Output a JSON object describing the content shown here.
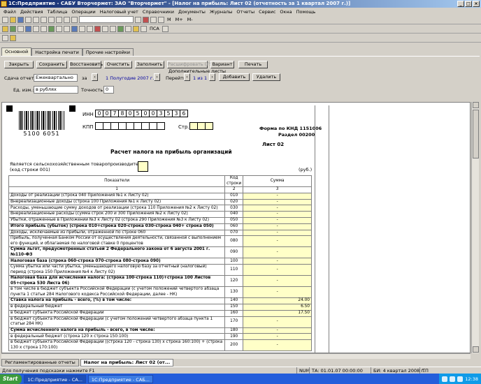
{
  "window": {
    "title": "1С:Предприятие - САБУ Вторчермет: ЗАО \"Вторчермет\" - [Налог на прибыль: Лист 02 (отчетность за 1 квартал 2007 г.)]"
  },
  "menu": [
    "Файл",
    "Действия",
    "Таблица",
    "Операции",
    "Налоговый учет",
    "Справочники",
    "Документы",
    "Журналы",
    "Отчеты",
    "Сервис",
    "Окна",
    "Помощь"
  ],
  "toolbar": {
    "m_label": "M",
    "mplus": "M+",
    "mminus": "M-",
    "pca": "ПСА"
  },
  "tabs": [
    "Основной",
    "Настройка печати",
    "Прочие настройки"
  ],
  "buttons": {
    "close": "Закрыть",
    "save": "Сохранить",
    "restore": "Восстановить",
    "clear": "Очистить",
    "fill": "Заполнить",
    "expand": "Расшифровать (F5)",
    "variant": "Вариант",
    "print": "Печать",
    "add": "Добавить",
    "remove": "Удалить"
  },
  "form": {
    "period_label": "Сдача отчета:",
    "period_value": "Ежеквартально",
    "za": "за",
    "period": "1 Полугодие 2007 г.",
    "extra_sheets": "Дополнительные листы",
    "goto": "Перейти",
    "sheet_pos": "1 из 1",
    "unit_label": "Ед. изм.:",
    "unit_value": "в рублях",
    "precision_label": "Точность:",
    "precision_value": "0"
  },
  "report": {
    "barcode_number": "5100 6051",
    "inn_label": "ИНН",
    "inn": [
      "0",
      "0",
      "7",
      "8",
      "0",
      "5",
      "0",
      "0",
      "3",
      "5",
      "3",
      "6"
    ],
    "kpp_label": "КПП",
    "page_label": "Стр.",
    "form_code": "Форма по КНД 1151006",
    "section": "Раздел 00200",
    "sheet": "Лист 02",
    "title": "Расчет налога на прибыль организаций",
    "agri_label": "Является сельскохозяйственным товаропроизводителем",
    "agri_code": "(код строки 001)",
    "currency": "(руб.)",
    "headers": {
      "col1": "Показатели",
      "col2": "Код строки",
      "col3": "Сумма"
    },
    "colnums": [
      "1",
      "2",
      "3"
    ],
    "rows": [
      {
        "name": "Доходы от реализации  (строка 040 Приложения №1 к Листу 02)",
        "code": "010",
        "value": "-",
        "bold": false
      },
      {
        "name": "Внереализационные доходы (строка 100 Приложения №1 к Листу 02)",
        "code": "020",
        "value": "-",
        "bold": false
      },
      {
        "name": "Расходы, уменьшающие сумму доходов от реализации (строка 110 Приложения №2 к Листу 02)",
        "code": "030",
        "value": "-",
        "bold": false
      },
      {
        "name": "Внереализационные расходы (сумма строк 200 и 300 Приложения №2 к Листу 02)",
        "code": "040",
        "value": "-",
        "bold": false
      },
      {
        "name": "Убытки, отраженные в Приложении №3 к Листу 02 (строка 290 Приложения №3 к Листу 02)",
        "code": "050",
        "value": "-",
        "bold": false
      },
      {
        "name": "Итого прибыль (убыток) (строка 010+строка 020-строка 030-строка 040+ строка 050)",
        "code": "060",
        "value": "-",
        "bold": true
      },
      {
        "name": "Доходы, исключаемые из прибыли, отраженной по строке 060",
        "code": "070",
        "value": "-",
        "bold": false
      },
      {
        "name": "Прибыль, полученная Банком России от осуществления деятельности, связанной с выполнением его функций, и облагаемая по налоговой ставке 0 процентов",
        "code": "080",
        "value": "-",
        "bold": false
      },
      {
        "name": "Сумма льгот, предусмотренных статьей 2 Федерального закона от 6 августа 2001 г. №110-ФЗ",
        "code": "090",
        "value": "-",
        "bold": true
      },
      {
        "name": "Налоговая база (строка 060-строка 070-строка 080-строка 090)",
        "code": "100",
        "value": "-",
        "bold": true
      },
      {
        "name": "Сумма убытка или части убытка, уменьшающего налоговую базу за отчетный (налоговый) период (строка 150 Приложения №4 к Листу 02)",
        "code": "110",
        "value": "-",
        "bold": false
      },
      {
        "name": "Налоговая база для исчисления налога: (строка 100-строка 110)+строка 100 Листов 05+строка 530 Листа 06)",
        "code": "120",
        "value": "-",
        "bold": true
      },
      {
        "name": "   в том числе в бюджет субъекта Российской Федерации (с учетом положений четвертого абзаца пункта 1 статьи 284 Налогового кодекса Российской Федерации, далее - НК)",
        "code": "130",
        "value": "-",
        "bold": false
      },
      {
        "name": "Ставка налога на прибыль - всего, (%) в том числе:",
        "code": "140",
        "value": "24.00",
        "bold": true
      },
      {
        "name": "   в федеральный бюджет",
        "code": "150",
        "value": "6.50",
        "bold": false
      },
      {
        "name": "   в бюджет субъекта Российской Федерации",
        "code": "160",
        "value": "17.50",
        "bold": false
      },
      {
        "name": "   в бюджет субъекта Российской Федерации (с учетом положений четвертого абзаца пункта 1 статьи 284 НК)",
        "code": "170",
        "value": "-",
        "bold": false
      },
      {
        "name": "Сумма исчисленного налога на прибыль - всего, в том числе:",
        "code": "180",
        "value": "-",
        "bold": true
      },
      {
        "name": "   в федеральный бюджет (строка 120 х строка 150:100)",
        "code": "190",
        "value": "-",
        "bold": false
      },
      {
        "name": "   в бюджет субъекта Российской Федерации ((строка 120 - строка 130) х строка 160:100) + (строка 130 х строка 170:100)",
        "code": "200",
        "value": "-",
        "bold": false
      }
    ]
  },
  "window_tabs": [
    "Регламентированные отчеты",
    "Налог на прибыль: Лист 02 (от..."
  ],
  "status": {
    "hint": "Для получения подсказки нажмите F1",
    "num": "NUM",
    "ta": "ТА: 01.01.07  00:00:00",
    "bi": "БИ: 4 квартал 2008 г.",
    "last": "ТП"
  },
  "taskbar": {
    "start": "Start",
    "tasks": [
      "1С:Предприятие - СА...",
      "1С:Предприятие - САБ..."
    ],
    "clock": "12:38"
  }
}
